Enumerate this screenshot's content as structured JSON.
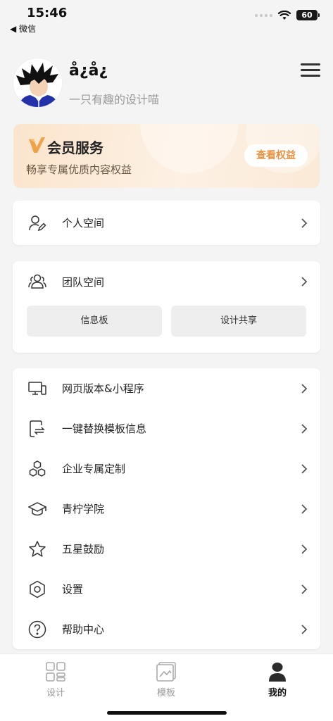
{
  "status_bar": {
    "time": "15:46",
    "back_app": "◀ 微信",
    "battery": "60"
  },
  "profile": {
    "username": "å¿å¿",
    "bio": "一只有趣的设计喵"
  },
  "vip": {
    "title": "会员服务",
    "subtitle": "畅享专属优质内容权益",
    "button": "查看权益",
    "accent": "#e8913f"
  },
  "personal": {
    "label": "个人空间"
  },
  "team": {
    "label": "团队空间",
    "buttons": [
      "信息板",
      "设计共享"
    ]
  },
  "menu": [
    {
      "label": "网页版本&小程序",
      "icon": "monitor-phone-icon"
    },
    {
      "label": "一键替换模板信息",
      "icon": "replace-icon"
    },
    {
      "label": "企业专属定制",
      "icon": "hexagons-icon"
    },
    {
      "label": "青柠学院",
      "icon": "graduation-cap-icon"
    },
    {
      "label": "五星鼓励",
      "icon": "star-icon"
    },
    {
      "label": "设置",
      "icon": "gear-icon"
    },
    {
      "label": "帮助中心",
      "icon": "question-icon"
    }
  ],
  "tabs": [
    {
      "label": "设计",
      "icon": "grid-icon",
      "active": false
    },
    {
      "label": "模板",
      "icon": "template-icon",
      "active": false
    },
    {
      "label": "我的",
      "icon": "person-icon",
      "active": true
    }
  ]
}
